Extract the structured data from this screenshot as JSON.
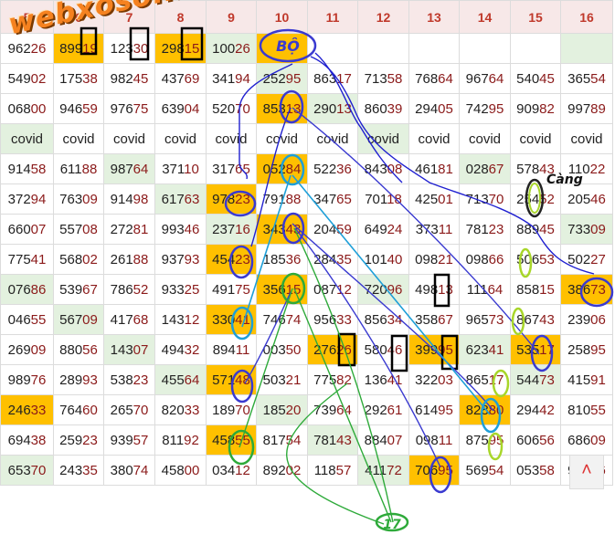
{
  "site_logo": "webxoso.net",
  "columns": [
    "5",
    "6",
    "7",
    "8",
    "9",
    "10",
    "11",
    "12",
    "13",
    "14",
    "15",
    "16"
  ],
  "rows": [
    [
      [
        "96226",
        ""
      ],
      [
        "89919",
        "o"
      ],
      [
        "12330",
        ""
      ],
      [
        "29815",
        "o"
      ],
      [
        "10026",
        "g"
      ],
      [
        "BỘ",
        "o"
      ],
      [
        "",
        ""
      ],
      [
        "",
        ""
      ],
      [
        "",
        ""
      ],
      [
        "",
        ""
      ],
      [
        "",
        ""
      ],
      [
        "",
        "g"
      ]
    ],
    [
      [
        "54902",
        ""
      ],
      [
        "17538",
        ""
      ],
      [
        "98245",
        ""
      ],
      [
        "43769",
        ""
      ],
      [
        "34194",
        ""
      ],
      [
        "25295",
        "g"
      ],
      [
        "86317",
        ""
      ],
      [
        "71358",
        ""
      ],
      [
        "76864",
        ""
      ],
      [
        "96764",
        ""
      ],
      [
        "54045",
        ""
      ],
      [
        "36554",
        ""
      ]
    ],
    [
      [
        "06800",
        ""
      ],
      [
        "94659",
        ""
      ],
      [
        "97675",
        ""
      ],
      [
        "63904",
        ""
      ],
      [
        "52070",
        ""
      ],
      [
        "85313",
        "o"
      ],
      [
        "29013",
        "g"
      ],
      [
        "86039",
        ""
      ],
      [
        "29405",
        ""
      ],
      [
        "74295",
        ""
      ],
      [
        "90982",
        ""
      ],
      [
        "99789",
        ""
      ]
    ],
    [
      [
        "covid",
        "g"
      ],
      [
        "covid",
        ""
      ],
      [
        "covid",
        ""
      ],
      [
        "covid",
        ""
      ],
      [
        "covid",
        ""
      ],
      [
        "covid",
        ""
      ],
      [
        "covid",
        ""
      ],
      [
        "covid",
        "g"
      ],
      [
        "covid",
        ""
      ],
      [
        "covid",
        ""
      ],
      [
        "covid",
        ""
      ],
      [
        "covid",
        ""
      ]
    ],
    [
      [
        "91458",
        ""
      ],
      [
        "61188",
        ""
      ],
      [
        "98764",
        "g"
      ],
      [
        "37110",
        ""
      ],
      [
        "31765",
        ""
      ],
      [
        "05284",
        "o"
      ],
      [
        "52236",
        ""
      ],
      [
        "84308",
        ""
      ],
      [
        "46181",
        ""
      ],
      [
        "02867",
        "g"
      ],
      [
        "57843",
        ""
      ],
      [
        "11022",
        ""
      ]
    ],
    [
      [
        "37294",
        ""
      ],
      [
        "76309",
        ""
      ],
      [
        "91498",
        ""
      ],
      [
        "61763",
        "g"
      ],
      [
        "97823",
        "o"
      ],
      [
        "79188",
        ""
      ],
      [
        "34765",
        ""
      ],
      [
        "70118",
        ""
      ],
      [
        "42501",
        ""
      ],
      [
        "71370",
        ""
      ],
      [
        "25452",
        ""
      ],
      [
        "20546",
        ""
      ]
    ],
    [
      [
        "66007",
        ""
      ],
      [
        "55708",
        ""
      ],
      [
        "27281",
        ""
      ],
      [
        "99346",
        ""
      ],
      [
        "23716",
        "g"
      ],
      [
        "34343",
        "o"
      ],
      [
        "20459",
        ""
      ],
      [
        "64924",
        ""
      ],
      [
        "37311",
        ""
      ],
      [
        "78123",
        ""
      ],
      [
        "88945",
        ""
      ],
      [
        "73309",
        "g"
      ]
    ],
    [
      [
        "77541",
        ""
      ],
      [
        "56802",
        ""
      ],
      [
        "26188",
        ""
      ],
      [
        "93793",
        ""
      ],
      [
        "45423",
        "o"
      ],
      [
        "18536",
        ""
      ],
      [
        "28435",
        ""
      ],
      [
        "10140",
        ""
      ],
      [
        "09821",
        ""
      ],
      [
        "09866",
        ""
      ],
      [
        "50653",
        ""
      ],
      [
        "50227",
        ""
      ]
    ],
    [
      [
        "07686",
        "g"
      ],
      [
        "53967",
        ""
      ],
      [
        "78652",
        ""
      ],
      [
        "93325",
        ""
      ],
      [
        "49175",
        ""
      ],
      [
        "35615",
        "o"
      ],
      [
        "08712",
        ""
      ],
      [
        "72096",
        "g"
      ],
      [
        "49813",
        ""
      ],
      [
        "11164",
        ""
      ],
      [
        "85815",
        ""
      ],
      [
        "38673",
        "o"
      ]
    ],
    [
      [
        "04655",
        ""
      ],
      [
        "56709",
        "g"
      ],
      [
        "41768",
        ""
      ],
      [
        "14312",
        ""
      ],
      [
        "33041",
        "o"
      ],
      [
        "74674",
        ""
      ],
      [
        "95633",
        ""
      ],
      [
        "85634",
        ""
      ],
      [
        "35867",
        ""
      ],
      [
        "96573",
        ""
      ],
      [
        "86743",
        ""
      ],
      [
        "23906",
        ""
      ]
    ],
    [
      [
        "26909",
        ""
      ],
      [
        "88056",
        ""
      ],
      [
        "14307",
        "g"
      ],
      [
        "49432",
        ""
      ],
      [
        "89411",
        ""
      ],
      [
        "00350",
        ""
      ],
      [
        "27626",
        "o"
      ],
      [
        "58046",
        ""
      ],
      [
        "39995",
        "o"
      ],
      [
        "62341",
        "g"
      ],
      [
        "53517",
        "o"
      ],
      [
        "25895",
        ""
      ]
    ],
    [
      [
        "98976",
        ""
      ],
      [
        "28993",
        ""
      ],
      [
        "53823",
        ""
      ],
      [
        "45564",
        "g"
      ],
      [
        "57148",
        "o"
      ],
      [
        "50321",
        ""
      ],
      [
        "77582",
        ""
      ],
      [
        "13641",
        ""
      ],
      [
        "32203",
        ""
      ],
      [
        "86517",
        ""
      ],
      [
        "54473",
        "g"
      ],
      [
        "41591",
        ""
      ]
    ],
    [
      [
        "24633",
        "o"
      ],
      [
        "76460",
        ""
      ],
      [
        "26570",
        ""
      ],
      [
        "82033",
        ""
      ],
      [
        "18970",
        ""
      ],
      [
        "18520",
        "g"
      ],
      [
        "73964",
        ""
      ],
      [
        "29261",
        ""
      ],
      [
        "61495",
        ""
      ],
      [
        "82880",
        "o"
      ],
      [
        "29442",
        ""
      ],
      [
        "81055",
        ""
      ]
    ],
    [
      [
        "69438",
        ""
      ],
      [
        "25923",
        ""
      ],
      [
        "93957",
        ""
      ],
      [
        "81192",
        ""
      ],
      [
        "45855",
        "o"
      ],
      [
        "81754",
        ""
      ],
      [
        "78143",
        "g"
      ],
      [
        "88407",
        ""
      ],
      [
        "09811",
        ""
      ],
      [
        "87595",
        ""
      ],
      [
        "60656",
        ""
      ],
      [
        "68609",
        ""
      ]
    ],
    [
      [
        "65370",
        "g"
      ],
      [
        "24335",
        ""
      ],
      [
        "38074",
        ""
      ],
      [
        "45800",
        ""
      ],
      [
        "03412",
        ""
      ],
      [
        "89202",
        ""
      ],
      [
        "11857",
        ""
      ],
      [
        "41172",
        "g"
      ],
      [
        "70695",
        "o"
      ],
      [
        "56954",
        ""
      ],
      [
        "05358",
        ""
      ],
      [
        "97836",
        ""
      ]
    ]
  ],
  "annotations": {
    "bo_label": "BỘ",
    "cang_label": "Càng",
    "sum_label": "17"
  },
  "scroll_up_icon": "chevron-up-icon",
  "colors": {
    "orange": "#ffc000",
    "green": "#e3f1df",
    "header_red": "#c0392b",
    "tail_red": "#8b1a1a"
  }
}
